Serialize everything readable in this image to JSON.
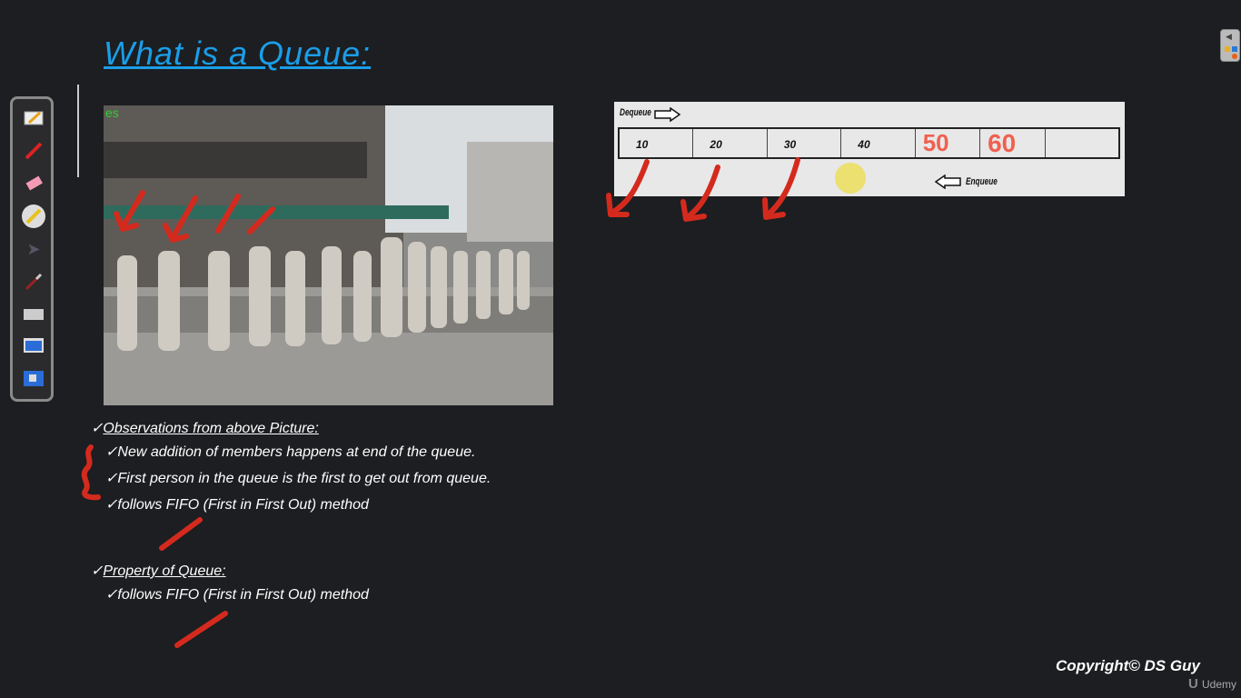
{
  "title": "What is a Queue:",
  "toolbar": {
    "tools": [
      "whiteboard-icon",
      "pen-icon",
      "eraser-icon",
      "highlighter-icon",
      "pointer-icon",
      "laser-pointer-icon",
      "keyboard-icon",
      "screen-capture-icon",
      "desktop-icon"
    ]
  },
  "photo": {
    "corner_text": "es"
  },
  "queue_diagram": {
    "dequeue_label": "Dequeue",
    "enqueue_label": "Enqueue",
    "cells": [
      "10",
      "20",
      "30",
      "40",
      "",
      "",
      ""
    ],
    "handwritten": [
      "50",
      "60"
    ]
  },
  "observations": {
    "heading": "Observations from above Picture:",
    "items": [
      "New addition of members happens at end of the queue.",
      "First person in the queue is the first to get out from queue.",
      "follows FIFO (First in First Out) method"
    ]
  },
  "property": {
    "heading": "Property of Queue:",
    "items": [
      "follows FIFO (First in First Out) method"
    ]
  },
  "check": "✓",
  "copyright": "Copyright© DS Guy",
  "brand": "Udemy",
  "colors": {
    "title": "#1a9ee8",
    "annotation": "#d42a1e",
    "background": "#1c1e21"
  }
}
